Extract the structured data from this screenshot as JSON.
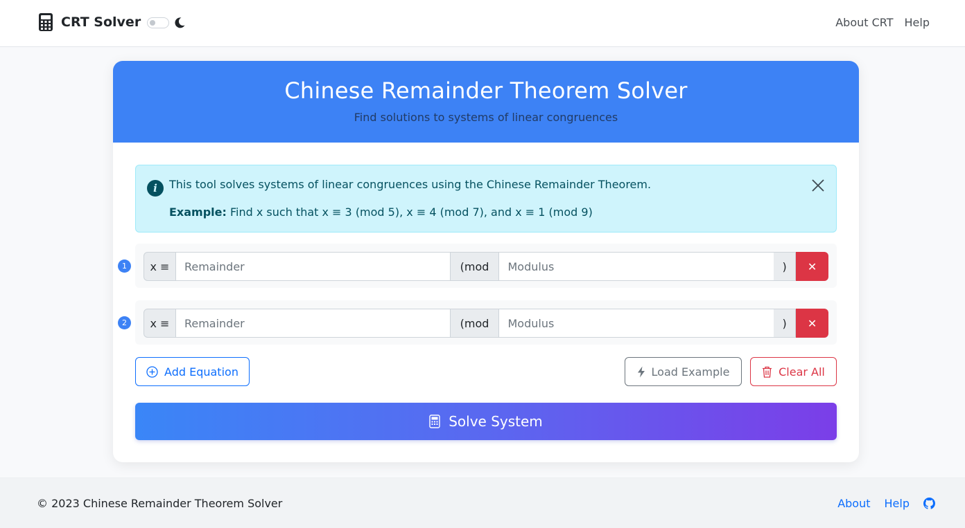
{
  "navbar": {
    "brand": "CRT Solver",
    "links": [
      "About CRT",
      "Help"
    ]
  },
  "header": {
    "title": "Chinese Remainder Theorem Solver",
    "subtitle": "Find solutions to systems of linear congruences"
  },
  "alert": {
    "message": "This tool solves systems of linear congruences using the Chinese Remainder Theorem.",
    "example_label": "Example:",
    "example_text": "Find x such that x ≡ 3 (mod 5), x ≡ 4 (mod 7), and x ≡ 1 (mod 9)"
  },
  "equations": [
    {
      "number": "1",
      "prefix": "x ≡",
      "remainder_placeholder": "Remainder",
      "mod_label": "(mod",
      "modulus_placeholder": "Modulus",
      "close_paren": ")",
      "delete_label": "✕"
    },
    {
      "number": "2",
      "prefix": "x ≡",
      "remainder_placeholder": "Remainder",
      "mod_label": "(mod",
      "modulus_placeholder": "Modulus",
      "close_paren": ")",
      "delete_label": "✕"
    }
  ],
  "actions": {
    "add_label": "Add Equation",
    "example_label": "Load Example",
    "clear_label": "Clear All",
    "solve_label": "Solve System"
  },
  "footer": {
    "copyright": "© 2023 Chinese Remainder Theorem Solver",
    "links": [
      "About",
      "Help"
    ]
  },
  "colors": {
    "primary": "#3d82f5",
    "danger": "#dc3545",
    "info_bg": "#cff4fc",
    "gradient_end": "#7b3ee8"
  },
  "icons": [
    "calculator-icon",
    "moon-icon",
    "info-icon",
    "close-icon",
    "plus-circle-icon",
    "lightning-icon",
    "trash-icon",
    "github-icon"
  ]
}
